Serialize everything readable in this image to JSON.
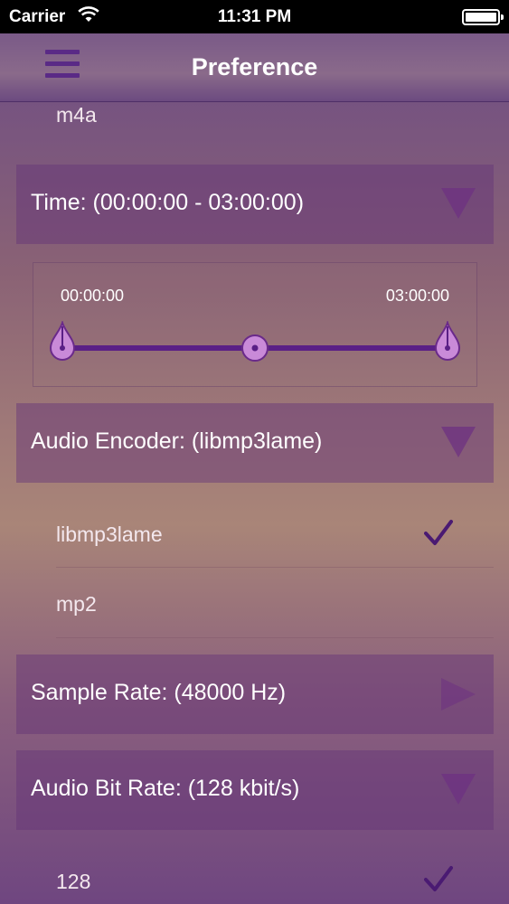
{
  "status_bar": {
    "carrier": "Carrier",
    "time": "11:31 PM"
  },
  "nav": {
    "title": "Preference",
    "menu_icon": "hamburger-menu-icon"
  },
  "format_option": "m4a",
  "time_section": {
    "label": "Time: (00:00:00 - 03:00:00)",
    "start_label": "00:00:00",
    "end_label": "03:00:00",
    "range_start_fraction": 0,
    "range_end_fraction": 1
  },
  "audio_encoder": {
    "label": "Audio Encoder: (libmp3lame)",
    "options": [
      {
        "label": "libmp3lame",
        "selected": true
      },
      {
        "label": "mp2",
        "selected": false
      }
    ]
  },
  "sample_rate": {
    "label": "Sample Rate: (48000 Hz)"
  },
  "audio_bit_rate": {
    "label": "Audio Bit Rate: (128 kbit/s)",
    "options": [
      {
        "label": "128",
        "selected": true
      }
    ]
  },
  "colors": {
    "accent": "#5a1f86",
    "thumb": "#c98ad8"
  }
}
